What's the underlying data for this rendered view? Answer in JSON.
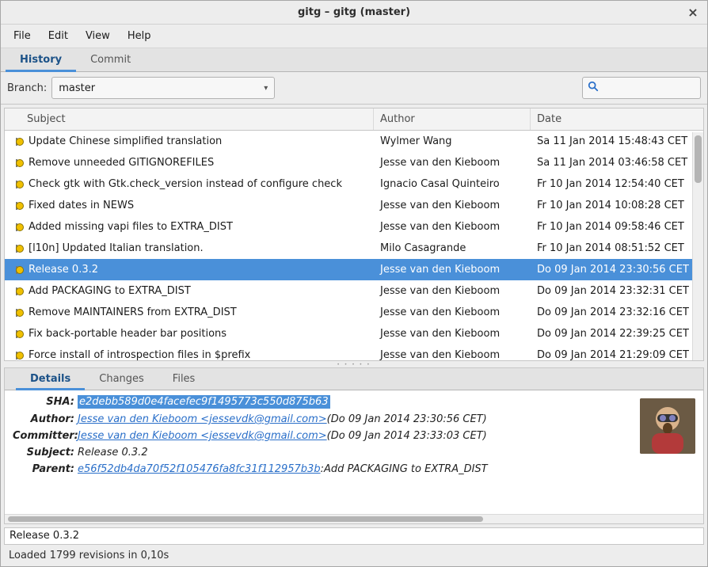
{
  "window": {
    "title": "gitg – gitg (master)"
  },
  "menu": {
    "file": "File",
    "edit": "Edit",
    "view": "View",
    "help": "Help"
  },
  "top_tabs": {
    "history": "History",
    "commit": "Commit"
  },
  "toolbar": {
    "branch_label": "Branch:",
    "branch_value": "master"
  },
  "columns": {
    "subject": "Subject",
    "author": "Author",
    "date": "Date"
  },
  "commits": [
    {
      "subject": "Update Chinese simplified translation",
      "author": "Wylmer Wang",
      "date": "Sa 11 Jan 2014 15:48:43 CET",
      "selected": false
    },
    {
      "subject": "Remove unneeded GITIGNOREFILES",
      "author": "Jesse van den Kieboom",
      "date": "Sa 11 Jan 2014 03:46:58 CET",
      "selected": false
    },
    {
      "subject": "Check gtk with Gtk.check_version instead of configure check",
      "author": "Ignacio Casal Quinteiro",
      "date": "Fr 10 Jan 2014 12:54:40 CET",
      "selected": false
    },
    {
      "subject": "Fixed dates in NEWS",
      "author": "Jesse van den Kieboom",
      "date": "Fr 10 Jan 2014 10:08:28 CET",
      "selected": false
    },
    {
      "subject": "Added missing vapi files to EXTRA_DIST",
      "author": "Jesse van den Kieboom",
      "date": "Fr 10 Jan 2014 09:58:46 CET",
      "selected": false
    },
    {
      "subject": "[l10n] Updated Italian translation.",
      "author": "Milo Casagrande",
      "date": "Fr 10 Jan 2014 08:51:52 CET",
      "selected": false
    },
    {
      "subject": "Release 0.3.2",
      "author": "Jesse van den Kieboom",
      "date": "Do 09 Jan 2014 23:30:56 CET",
      "selected": true
    },
    {
      "subject": "Add PACKAGING to EXTRA_DIST",
      "author": "Jesse van den Kieboom",
      "date": "Do 09 Jan 2014 23:32:31 CET",
      "selected": false
    },
    {
      "subject": "Remove MAINTAINERS from EXTRA_DIST",
      "author": "Jesse van den Kieboom",
      "date": "Do 09 Jan 2014 23:32:16 CET",
      "selected": false
    },
    {
      "subject": "Fix back-portable header bar positions",
      "author": "Jesse van den Kieboom",
      "date": "Do 09 Jan 2014 22:39:25 CET",
      "selected": false
    },
    {
      "subject": "Force install of introspection files in $prefix",
      "author": "Jesse van den Kieboom",
      "date": "Do 09 Jan 2014 21:29:09 CET",
      "selected": false
    }
  ],
  "details_tabs": {
    "details": "Details",
    "changes": "Changes",
    "files": "Files"
  },
  "details": {
    "sha_label": "SHA:",
    "sha": "e2debb589d0e4facefec9f1495773c550d875b63",
    "author_label": "Author:",
    "author_link": "Jesse van den Kieboom <jessevdk@gmail.com>",
    "author_suffix": " (Do 09 Jan 2014 23:30:56 CET)",
    "committer_label": "Committer:",
    "committer_link": "Jesse van den Kieboom <jessevdk@gmail.com>",
    "committer_suffix": " (Do 09 Jan 2014 23:33:03 CET)",
    "subject_label": "Subject:",
    "subject": "Release 0.3.2",
    "parent_label": "Parent:",
    "parent_link": "e56f52db4da70f52f105476fa8fc31f112957b3b",
    "parent_sep": " : ",
    "parent_msg": "Add PACKAGING to EXTRA_DIST"
  },
  "tag_box": "Release 0.3.2",
  "status": "Loaded 1799 revisions in 0,10s"
}
